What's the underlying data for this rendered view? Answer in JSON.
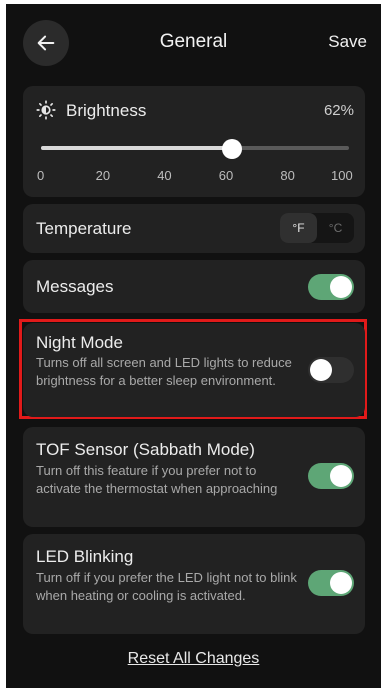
{
  "header": {
    "back_icon": "arrow-left-icon",
    "title": "General",
    "save_label": "Save"
  },
  "brightness": {
    "icon": "sun-icon",
    "label": "Brightness",
    "value_text": "62%",
    "level": 0.62,
    "ticks": [
      "0",
      "20",
      "40",
      "60",
      "80",
      "100"
    ]
  },
  "temperature": {
    "label": "Temperature",
    "units": [
      "°F",
      "°C"
    ],
    "selected": "°F"
  },
  "messages": {
    "label": "Messages",
    "enabled": true
  },
  "night_mode": {
    "label": "Night Mode",
    "description": "Turns off all screen and LED lights to reduce brightness for a better sleep environment.",
    "enabled": false
  },
  "tof_sensor": {
    "label": "TOF Sensor (Sabbath Mode)",
    "description": "Turn off this feature if you prefer not to activate the thermostat when approaching",
    "enabled": true
  },
  "led_blinking": {
    "label": "LED Blinking",
    "description": "Turn off if you prefer the LED light not to blink when heating or cooling is activated.",
    "enabled": true
  },
  "footer": {
    "reset_label": "Reset All Changes"
  },
  "colors": {
    "background": "#111111",
    "card": "#222222",
    "toggle_on": "#5ea676",
    "highlight": "#e11a1a"
  }
}
